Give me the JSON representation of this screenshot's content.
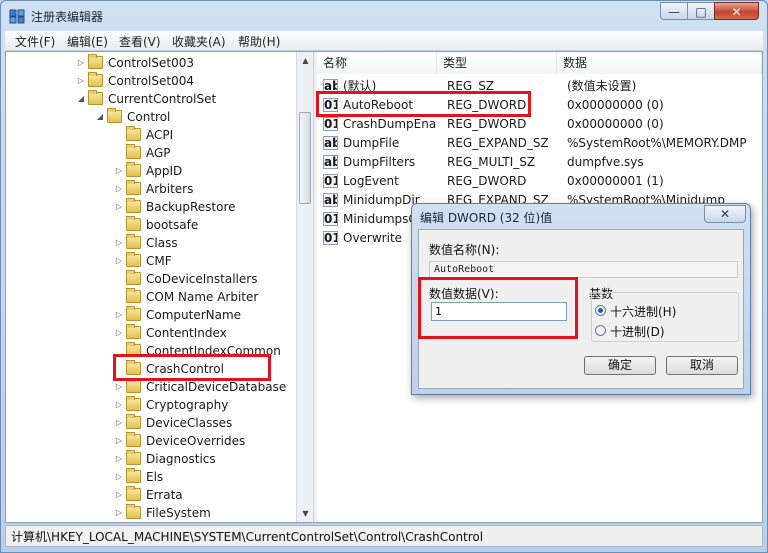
{
  "window": {
    "title": "注册表编辑器",
    "controls": {
      "minimize": "—",
      "maximize": "□",
      "close": "✕"
    }
  },
  "menu": [
    "文件(F)",
    "编辑(E)",
    "查看(V)",
    "收藏夹(A)",
    "帮助(H)"
  ],
  "tree": [
    {
      "label": "ControlSet003",
      "expander": "▷"
    },
    {
      "label": "ControlSet004",
      "expander": "▷"
    },
    {
      "label": "CurrentControlSet",
      "expander": "◢"
    },
    {
      "label": "Control",
      "expander": "◢"
    },
    {
      "label": "ACPI",
      "expander": ""
    },
    {
      "label": "AGP",
      "expander": ""
    },
    {
      "label": "AppID",
      "expander": "▷"
    },
    {
      "label": "Arbiters",
      "expander": "▷"
    },
    {
      "label": "BackupRestore",
      "expander": "▷"
    },
    {
      "label": "bootsafe",
      "expander": ""
    },
    {
      "label": "Class",
      "expander": "▷"
    },
    {
      "label": "CMF",
      "expander": "▷"
    },
    {
      "label": "CoDeviceInstallers",
      "expander": ""
    },
    {
      "label": "COM Name Arbiter",
      "expander": ""
    },
    {
      "label": "ComputerName",
      "expander": "▷"
    },
    {
      "label": "ContentIndex",
      "expander": "▷"
    },
    {
      "label": "ContentIndexCommon",
      "expander": ""
    },
    {
      "label": "CrashControl",
      "expander": ""
    },
    {
      "label": "CriticalDeviceDatabase",
      "expander": "▷"
    },
    {
      "label": "Cryptography",
      "expander": "▷"
    },
    {
      "label": "DeviceClasses",
      "expander": "▷"
    },
    {
      "label": "DeviceOverrides",
      "expander": "▷"
    },
    {
      "label": "Diagnostics",
      "expander": "▷"
    },
    {
      "label": "Els",
      "expander": "▷"
    },
    {
      "label": "Errata",
      "expander": "▷"
    },
    {
      "label": "FileSystem",
      "expander": "▷"
    }
  ],
  "columns": {
    "name": "名称",
    "type": "类型",
    "data": "数据"
  },
  "values": [
    {
      "icon": "ab",
      "name": "(默认)",
      "type": "REG_SZ",
      "data": "(数值未设置)"
    },
    {
      "icon": "bin",
      "name": "AutoReboot",
      "type": "REG_DWORD",
      "data": "0x00000000 (0)"
    },
    {
      "icon": "bin",
      "name": "CrashDumpEna...",
      "type": "REG_DWORD",
      "data": "0x00000000 (0)"
    },
    {
      "icon": "ab",
      "name": "DumpFile",
      "type": "REG_EXPAND_SZ",
      "data": "%SystemRoot%\\MEMORY.DMP"
    },
    {
      "icon": "ab",
      "name": "DumpFilters",
      "type": "REG_MULTI_SZ",
      "data": "dumpfve.sys"
    },
    {
      "icon": "bin",
      "name": "LogEvent",
      "type": "REG_DWORD",
      "data": "0x00000001 (1)"
    },
    {
      "icon": "ab",
      "name": "MinidumpDir",
      "type": "REG_EXPAND_SZ",
      "data": "%SystemRoot%\\Minidump"
    },
    {
      "icon": "bin",
      "name": "MinidumpsCo",
      "type": "",
      "data": ""
    },
    {
      "icon": "bin",
      "name": "Overwrite",
      "type": "",
      "data": ""
    }
  ],
  "status": "计算机\\HKEY_LOCAL_MACHINE\\SYSTEM\\CurrentControlSet\\Control\\CrashControl",
  "dialog": {
    "title": "编辑 DWORD (32 位)值",
    "close": "✕",
    "name_label": "数值名称(N):",
    "name_value": "AutoReboot",
    "data_label": "数值数据(V):",
    "data_value": "1",
    "base_label": "基数",
    "hex_label": "十六进制(H)",
    "dec_label": "十进制(D)",
    "selected_base": "hex",
    "ok": "确定",
    "cancel": "取消"
  },
  "colors": {
    "highlight": "#e3121b",
    "title_gradient": "#cfe0f2"
  }
}
